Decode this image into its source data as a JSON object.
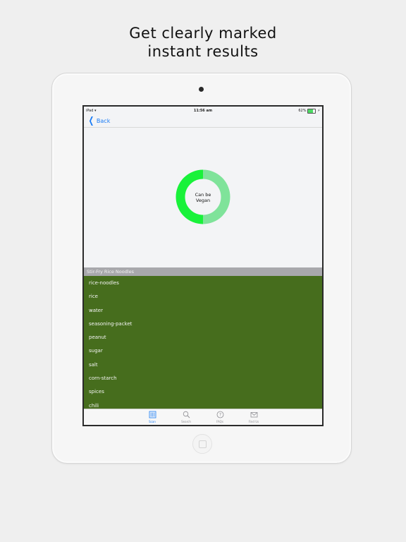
{
  "headline": {
    "line1": "Get clearly marked",
    "line2": "instant results"
  },
  "status_bar": {
    "device": "iPad",
    "time": "11:56 am",
    "battery_text": "62%",
    "battery_level": 0.62
  },
  "nav": {
    "back_label": "Back"
  },
  "result": {
    "label_line1": "Can be",
    "label_line2": "Vegan",
    "primary_color": "#19f23a",
    "secondary_color": "#7fe39a",
    "primary_fraction": 0.5
  },
  "product": {
    "name": "Stir-Fry Rice Noodles",
    "list_bg_color": "#466d1d",
    "ingredients": [
      "rice-noodles",
      "rice",
      "water",
      "seasoning-packet",
      "peanut",
      "sugar",
      "salt",
      "corn-starch",
      "spices",
      "chili"
    ]
  },
  "tabs": [
    {
      "label": "Scan",
      "icon": "scan-icon",
      "active": true
    },
    {
      "label": "Search",
      "icon": "search-icon",
      "active": false
    },
    {
      "label": "FAQs",
      "icon": "question-icon",
      "active": false
    },
    {
      "label": "Find Us",
      "icon": "mail-icon",
      "active": false
    }
  ],
  "accent_color": "#1a7cf5"
}
